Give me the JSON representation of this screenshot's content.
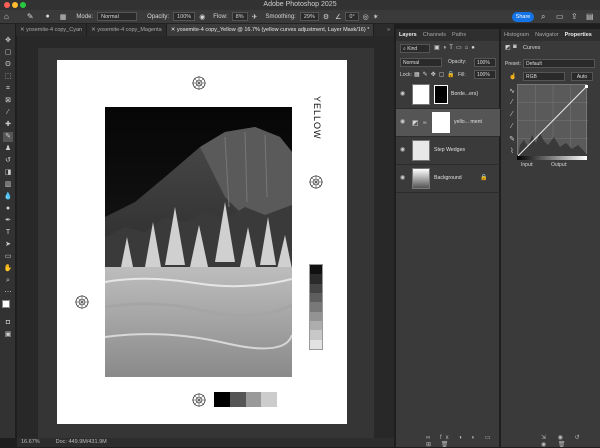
{
  "app": {
    "title": "Adobe Photoshop 2025"
  },
  "options_bar": {
    "mode_label": "Mode:",
    "mode_value": "Normal",
    "opacity_label": "Opacity:",
    "opacity_value": "100%",
    "flow_label": "Flow:",
    "flow_value": "8%",
    "smoothing_label": "Smoothing:",
    "smoothing_value": "29%",
    "angle_value": "0°",
    "share_label": "Share"
  },
  "doc_tabs": [
    {
      "label": "yosemite-4 copy_Cyan"
    },
    {
      "label": "yosemite-4 copy_Magenta"
    },
    {
      "label": "yosemite-4 copy_Yellow @ 16.7% (yellow curves adjustment, Layer Mask/16) *"
    }
  ],
  "tabs_overflow": "»",
  "document": {
    "vertical_label": "YELLOW"
  },
  "status": {
    "zoom": "16.67%",
    "doc_size": "Doc: 449.9M/431.9M"
  },
  "layers_panel": {
    "tabs": [
      "Layers",
      "Channels",
      "Paths"
    ],
    "kind_label": "Kind",
    "blend_mode": "Normal",
    "opacity_label": "Opacity:",
    "opacity_value": "100%",
    "lock_label": "Lock:",
    "fill_label": "Fill:",
    "fill_value": "100%",
    "layers": [
      {
        "name": "Borde...ers}",
        "selected": false
      },
      {
        "name": "yello... ment",
        "selected": true
      },
      {
        "name": "Step Wedges",
        "selected": false
      },
      {
        "name": "Background",
        "selected": false
      }
    ]
  },
  "props_panel": {
    "tabs": [
      "Histogram",
      "Navigator",
      "Properties"
    ],
    "title": "Curves",
    "preset_label": "Preset:",
    "preset_value": "Default",
    "channel_value": "RGB",
    "auto_label": "Auto",
    "input_label": "Input:",
    "output_label": "Output:"
  },
  "wedge_vertical": [
    "#111111",
    "#2a2a2a",
    "#444444",
    "#5e5e5e",
    "#787878",
    "#939393",
    "#adadad",
    "#c8c8c8",
    "#e2e2e2"
  ],
  "wedge_horizontal": [
    "#000000",
    "#555555",
    "#999999",
    "#cccccc"
  ],
  "colors": {
    "accent": "#1473e6",
    "selected_layer": "#555555"
  }
}
